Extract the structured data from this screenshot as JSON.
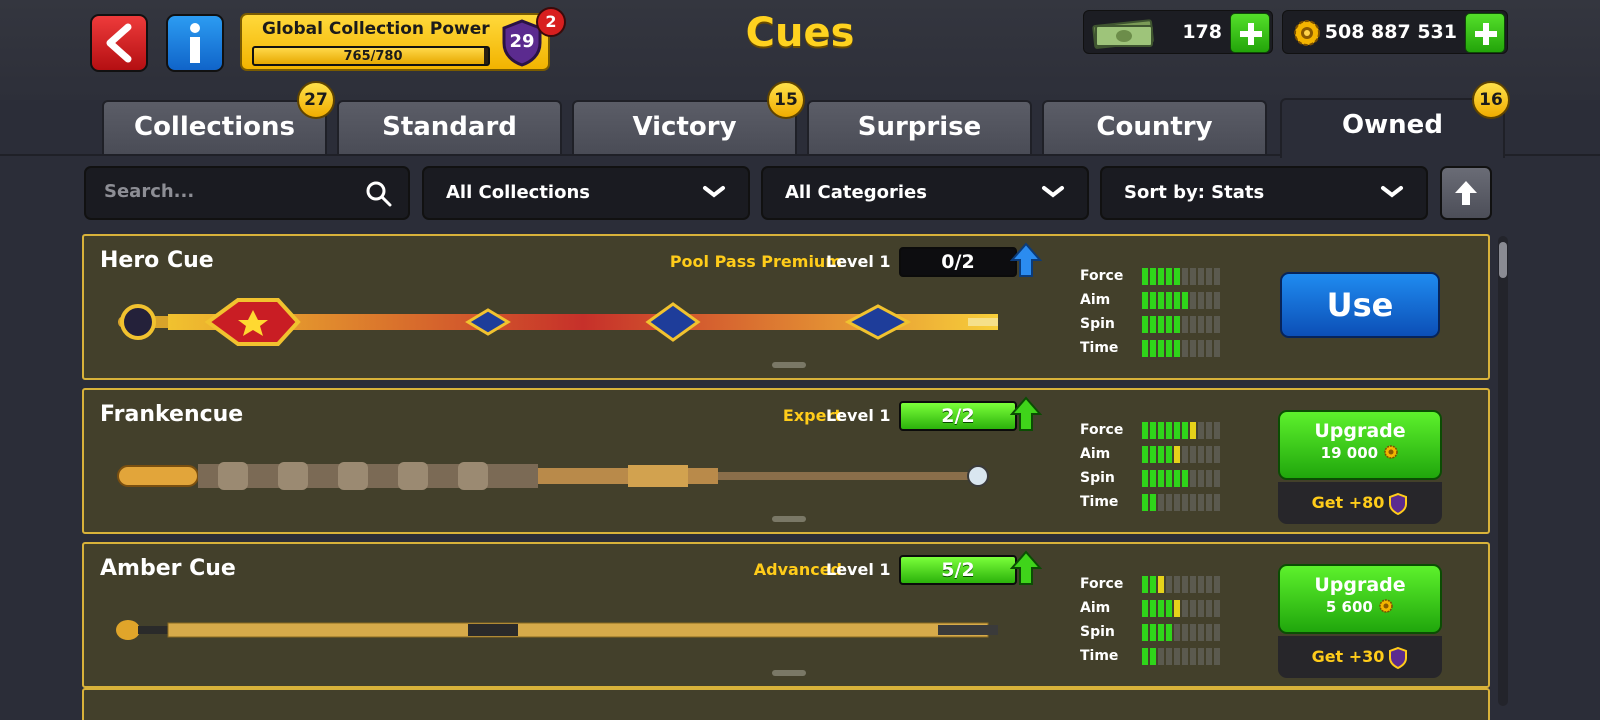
{
  "header": {
    "title": "Cues",
    "global_collection_power": {
      "label": "Global Collection Power",
      "progress_text": "765/780",
      "progress_value": 765,
      "progress_max": 780,
      "level": "29",
      "notification_count": "2"
    },
    "cash": {
      "value": "178",
      "icon": "cash-icon"
    },
    "coins": {
      "value": "508 887 531",
      "icon": "coin-icon"
    }
  },
  "tabs": [
    {
      "label": "Collections",
      "badge": "27",
      "active": false
    },
    {
      "label": "Standard",
      "badge": "",
      "active": false
    },
    {
      "label": "Victory",
      "badge": "15",
      "active": false
    },
    {
      "label": "Surprise",
      "badge": "",
      "active": false
    },
    {
      "label": "Country",
      "badge": "",
      "active": false
    },
    {
      "label": "Owned",
      "badge": "16",
      "active": true
    }
  ],
  "filters": {
    "search_placeholder": "Search...",
    "collection": "All Collections",
    "category": "All Categories",
    "sort": "Sort by: Stats"
  },
  "stat_labels": [
    "Force",
    "Aim",
    "Spin",
    "Time"
  ],
  "cues": [
    {
      "name": "Hero Cue",
      "rarity": "Pool Pass Premium",
      "level": "Level 1",
      "progress": "0/2",
      "upgradeable": false,
      "stats": {
        "Force": 5,
        "Aim": 6,
        "Spin": 5,
        "Time": 5
      },
      "action": "Use"
    },
    {
      "name": "Frankencue",
      "rarity": "Expert",
      "level": "Level 1",
      "progress": "2/2",
      "upgradeable": true,
      "stats": {
        "Force": 7,
        "Aim": 5,
        "Spin": 6,
        "Time": 2
      },
      "action": "Upgrade",
      "cost": "19 000",
      "bonus": "Get +80"
    },
    {
      "name": "Amber Cue",
      "rarity": "Advanced",
      "level": "Level 1",
      "progress": "5/2",
      "upgradeable": true,
      "stats": {
        "Force": 3,
        "Aim": 5,
        "Spin": 4,
        "Time": 2
      },
      "action": "Upgrade",
      "cost": "5 600",
      "bonus": "Get +30"
    }
  ],
  "colors": {
    "accent_gold": "#ffd21f",
    "card_border": "#d8b23a",
    "stat_green": "#2fd51a",
    "stat_yellow": "#e6d21a"
  }
}
